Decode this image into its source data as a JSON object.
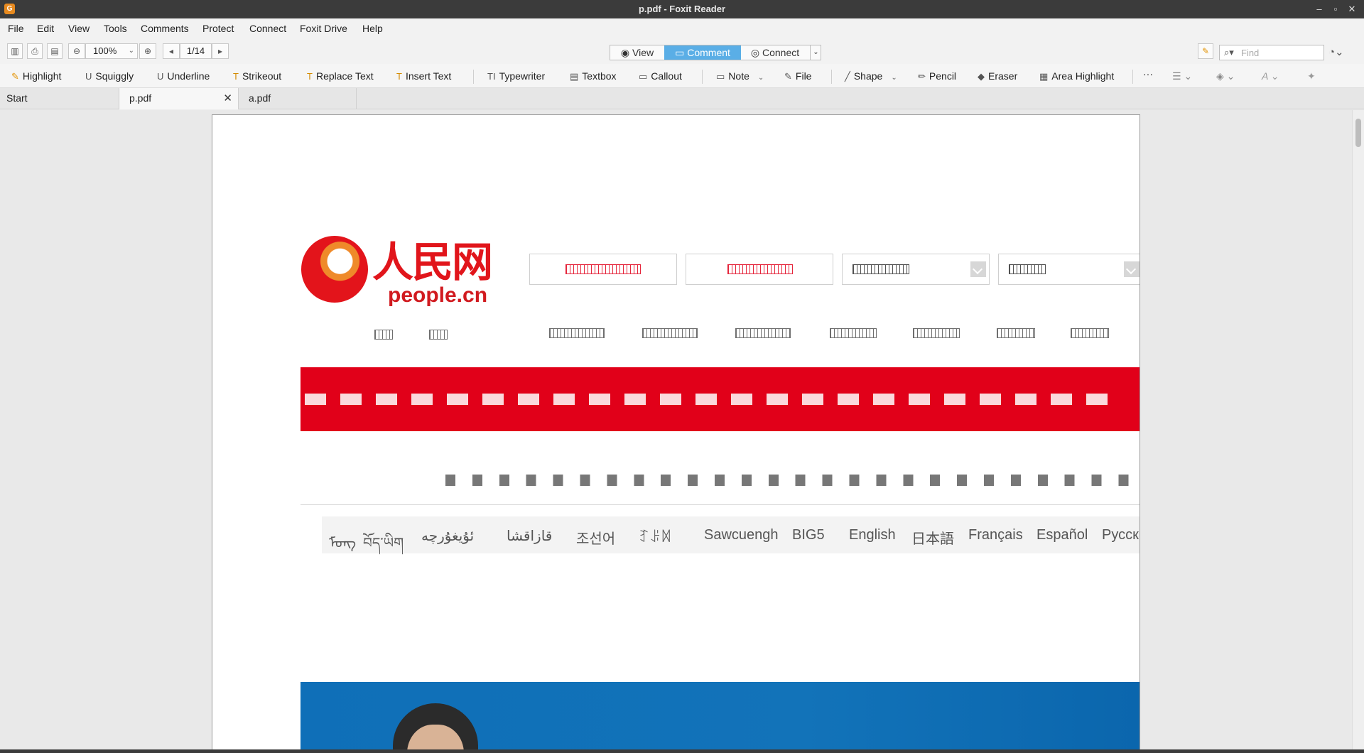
{
  "window": {
    "title": "p.pdf - Foxit Reader",
    "app_icon": "G"
  },
  "menu": [
    "File",
    "Edit",
    "View",
    "Tools",
    "Comments",
    "Protect",
    "Connect",
    "Foxit Drive",
    "Help"
  ],
  "toolbar": {
    "zoom_value": "100%",
    "page_value": "1/14",
    "modes": [
      "View",
      "Comment",
      "Connect"
    ],
    "active_mode": "Comment",
    "find_placeholder": "Find"
  },
  "comment_tools": [
    "Highlight",
    "Squiggly",
    "Underline",
    "Strikeout",
    "Replace Text",
    "Insert Text",
    "Typewriter",
    "Textbox",
    "Callout",
    "Note",
    "File",
    "Shape",
    "Pencil",
    "Eraser",
    "Area Highlight",
    "···"
  ],
  "tabs": [
    {
      "label": "Start"
    },
    {
      "label": "p.pdf"
    },
    {
      "label": "a.pdf"
    }
  ],
  "page": {
    "logo_cn": "人民网",
    "logo_en": "people.cn",
    "languages": [
      "ᠮᠣᠩ",
      "བོད་ཡིག",
      "ئۇيغۇرچە",
      "قازاقشا",
      "조선어",
      "ꆈꌠꉙ",
      "Sawcuengh",
      "BIG5",
      "English",
      "日本語",
      "Français",
      "Español",
      "Русски"
    ]
  },
  "colors": {
    "brand_red": "#e10019",
    "accent_blue": "#5aaee6",
    "titlebar": "#3b3b3b"
  }
}
